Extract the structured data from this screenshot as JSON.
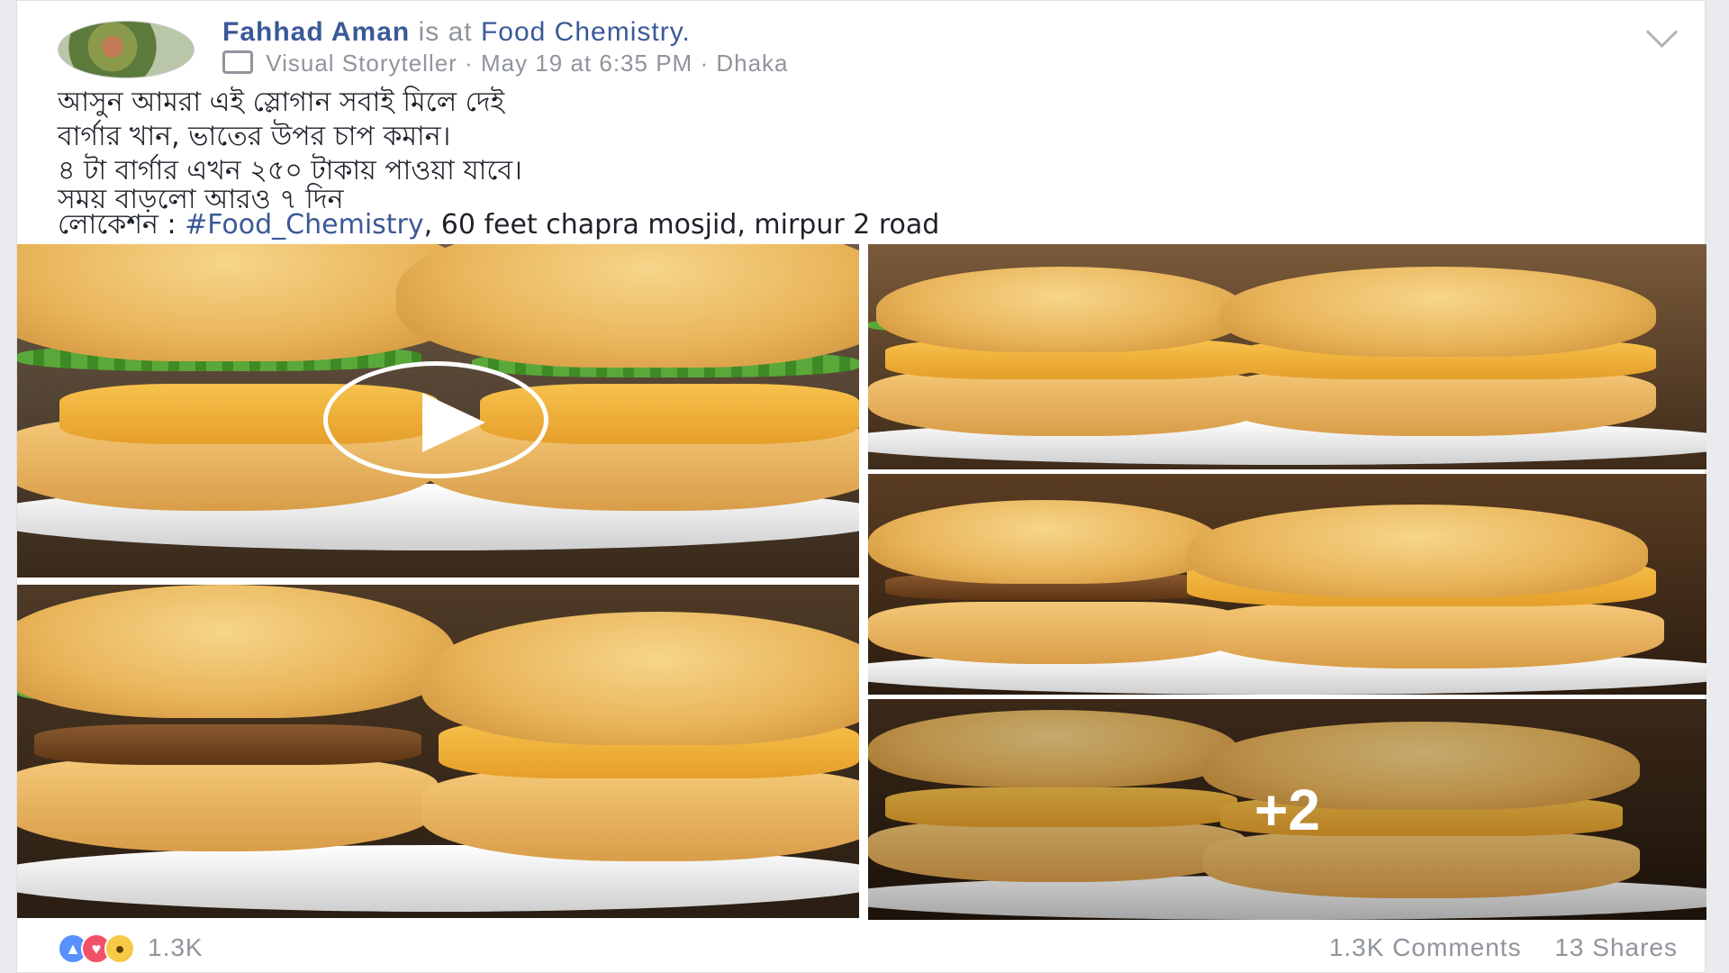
{
  "post": {
    "author": "Fahhad Aman",
    "is_at": "is at",
    "location_link": "Food Chemistry.",
    "badge": "Visual Storyteller",
    "sep": "·",
    "time": "May 19 at 6:35 PM",
    "place": "Dhaka",
    "lines": [
      "আসুন আমরা এই স্লোগান সবাই মিলে দেই",
      "বার্গার খান, ভাতের উপর চাপ কমান।",
      "৪ টা বার্গার এখন ২৫০ টাকায় পাওয়া যাবে।",
      "সময় বাড়লো আরও ৭ দিন"
    ],
    "location_prefix": "লোকেশন : ",
    "hashtag": "#Food_Chemistry",
    "location_suffix": ", 60 feet chapra mosjid, mirpur 2 road",
    "more_photos": "+2",
    "reactions_count": "1.3K",
    "comments": "1.3K Comments",
    "shares": "13 Shares"
  },
  "icons": {
    "like": "like-reaction-icon",
    "love": "love-reaction-icon",
    "wow": "wow-reaction-icon",
    "play": "play-icon",
    "chevron": "chevron-down-icon"
  }
}
